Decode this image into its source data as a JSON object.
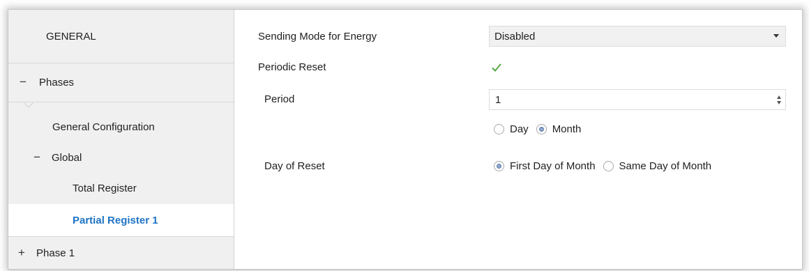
{
  "sidebar": {
    "items": [
      {
        "label": "GENERAL",
        "sign": ""
      },
      {
        "label": "Phases",
        "sign": "−"
      },
      {
        "label": "General Configuration",
        "sign": ""
      },
      {
        "label": "Global",
        "sign": "−"
      },
      {
        "label": "Total Register",
        "sign": ""
      },
      {
        "label": "Partial Register 1",
        "sign": ""
      },
      {
        "label": "Phase 1",
        "sign": "+"
      }
    ]
  },
  "main": {
    "sending_mode": {
      "label": "Sending Mode for Energy",
      "value": "Disabled"
    },
    "periodic_reset": {
      "label": "Periodic Reset",
      "checked": true
    },
    "period": {
      "label": "Period",
      "value": "1",
      "units": [
        "Day",
        "Month"
      ],
      "selected_unit": "Month"
    },
    "day_of_reset": {
      "label": "Day of Reset",
      "options": [
        "First Day of Month",
        "Same Day of Month"
      ],
      "selected": "First Day of Month"
    }
  },
  "colors": {
    "accent": "#1e73c4",
    "check": "#5aa843",
    "radio_fill": "#8ea7cf"
  }
}
